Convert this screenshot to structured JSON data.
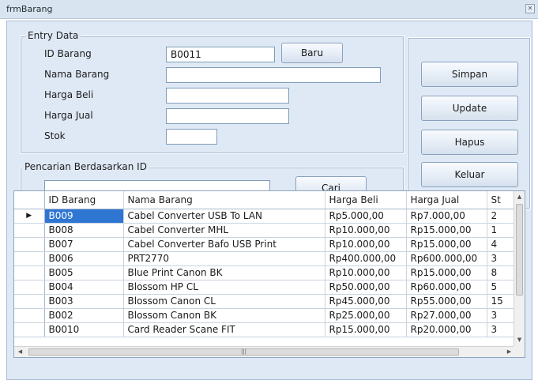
{
  "window": {
    "title": "frmBarang"
  },
  "entry": {
    "legend": "Entry Data",
    "id_label": "ID Barang",
    "id_value": "B0011",
    "nama_label": "Nama Barang",
    "nama_value": "",
    "beli_label": "Harga Beli",
    "beli_value": "",
    "jual_label": "Harga Jual",
    "jual_value": "",
    "stok_label": "Stok",
    "stok_value": "",
    "baru_label": "Baru"
  },
  "search": {
    "legend": "Pencarian Berdasarkan ID",
    "value": "",
    "cari_label": "Cari"
  },
  "actions": {
    "simpan": "Simpan",
    "update": "Update",
    "hapus": "Hapus",
    "keluar": "Keluar"
  },
  "grid": {
    "columns": [
      "ID Barang",
      "Nama Barang",
      "Harga Beli",
      "Harga Jual",
      "St"
    ],
    "current_row_marker": "▶",
    "rows": [
      [
        "B009",
        "Cabel Converter USB To LAN",
        "Rp5.000,00",
        "Rp7.000,00",
        "2"
      ],
      [
        "B008",
        "Cabel Converter MHL",
        "Rp10.000,00",
        "Rp15.000,00",
        "1"
      ],
      [
        "B007",
        "Cabel Converter Bafo USB Print",
        "Rp10.000,00",
        "Rp15.000,00",
        "4"
      ],
      [
        "B006",
        "PRT2770",
        "Rp400.000,00",
        "Rp600.000,00",
        "3"
      ],
      [
        "B005",
        "Blue Print Canon BK",
        "Rp10.000,00",
        "Rp15.000,00",
        "8"
      ],
      [
        "B004",
        "Blossom HP CL",
        "Rp50.000,00",
        "Rp60.000,00",
        "5"
      ],
      [
        "B003",
        "Blossom Canon CL",
        "Rp45.000,00",
        "Rp55.000,00",
        "15"
      ],
      [
        "B002",
        "Blossom Canon BK",
        "Rp25.000,00",
        "Rp27.000,00",
        "3"
      ],
      [
        "B0010",
        "Card Reader Scane FIT",
        "Rp15.000,00",
        "Rp20.000,00",
        "3"
      ]
    ]
  },
  "icons": {
    "close": "close-icon",
    "scroll_up": "scroll-up-icon",
    "scroll_down": "scroll-down-icon",
    "scroll_left": "scroll-left-icon",
    "scroll_right": "scroll-right-icon",
    "row_pointer": "row-pointer-icon"
  },
  "colors": {
    "selection": "#2f76d2",
    "form_background": "#dfe9f5"
  }
}
